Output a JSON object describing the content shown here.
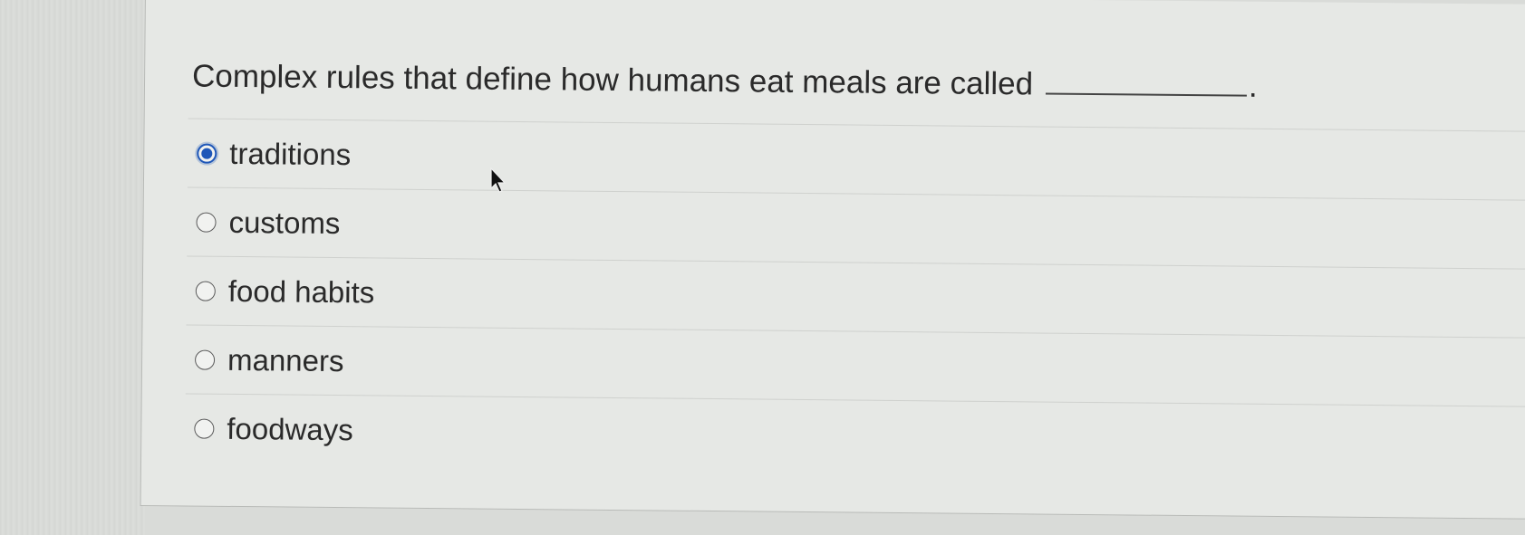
{
  "question": {
    "text": "Complex rules that define how humans eat meals are called",
    "end_punctuation": "."
  },
  "options": [
    {
      "label": "traditions",
      "selected": true
    },
    {
      "label": "customs",
      "selected": false
    },
    {
      "label": "food habits",
      "selected": false
    },
    {
      "label": "manners",
      "selected": false
    },
    {
      "label": "foodways",
      "selected": false
    }
  ],
  "colors": {
    "accent": "#1f57b8",
    "text": "#2a2a2a",
    "card_background": "#e6e8e5"
  }
}
